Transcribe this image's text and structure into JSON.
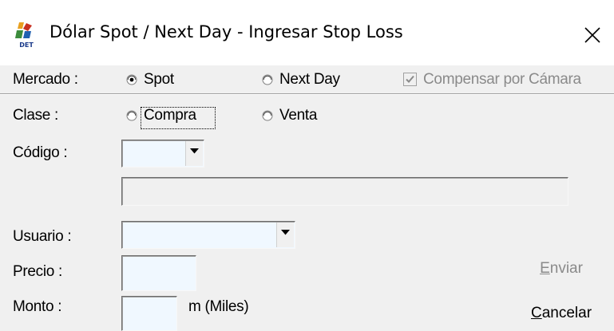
{
  "window": {
    "title": "Dólar Spot / Next Day - Ingresar Stop Loss",
    "close_symbol": "✕",
    "app_icon": "det-logo-icon"
  },
  "mercado": {
    "label": "Mercado :",
    "options": [
      "Spot",
      "Next Day"
    ],
    "selected": "Spot",
    "compensar_label": "Compensar por Cámara",
    "compensar_checked": true,
    "compensar_enabled": false
  },
  "clase": {
    "label": "Clase :",
    "options": [
      "Compra",
      "Venta"
    ],
    "selected": null
  },
  "codigo": {
    "label": "Código :",
    "value": ""
  },
  "descripcion": {
    "value": ""
  },
  "usuario": {
    "label": "Usuario :",
    "value": ""
  },
  "precio": {
    "label": "Precio :",
    "value": ""
  },
  "monto": {
    "label": "Monto :",
    "value": "",
    "unit": "m (Miles)"
  },
  "buttons": {
    "enviar": {
      "label": "Enviar",
      "enabled": false
    },
    "cancelar": {
      "label": "Cancelar",
      "enabled": true
    }
  },
  "colors": {
    "field_bg": "#f0f8ff",
    "window_bg": "#f0f0f0",
    "disabled_text": "#8a8a8a"
  }
}
